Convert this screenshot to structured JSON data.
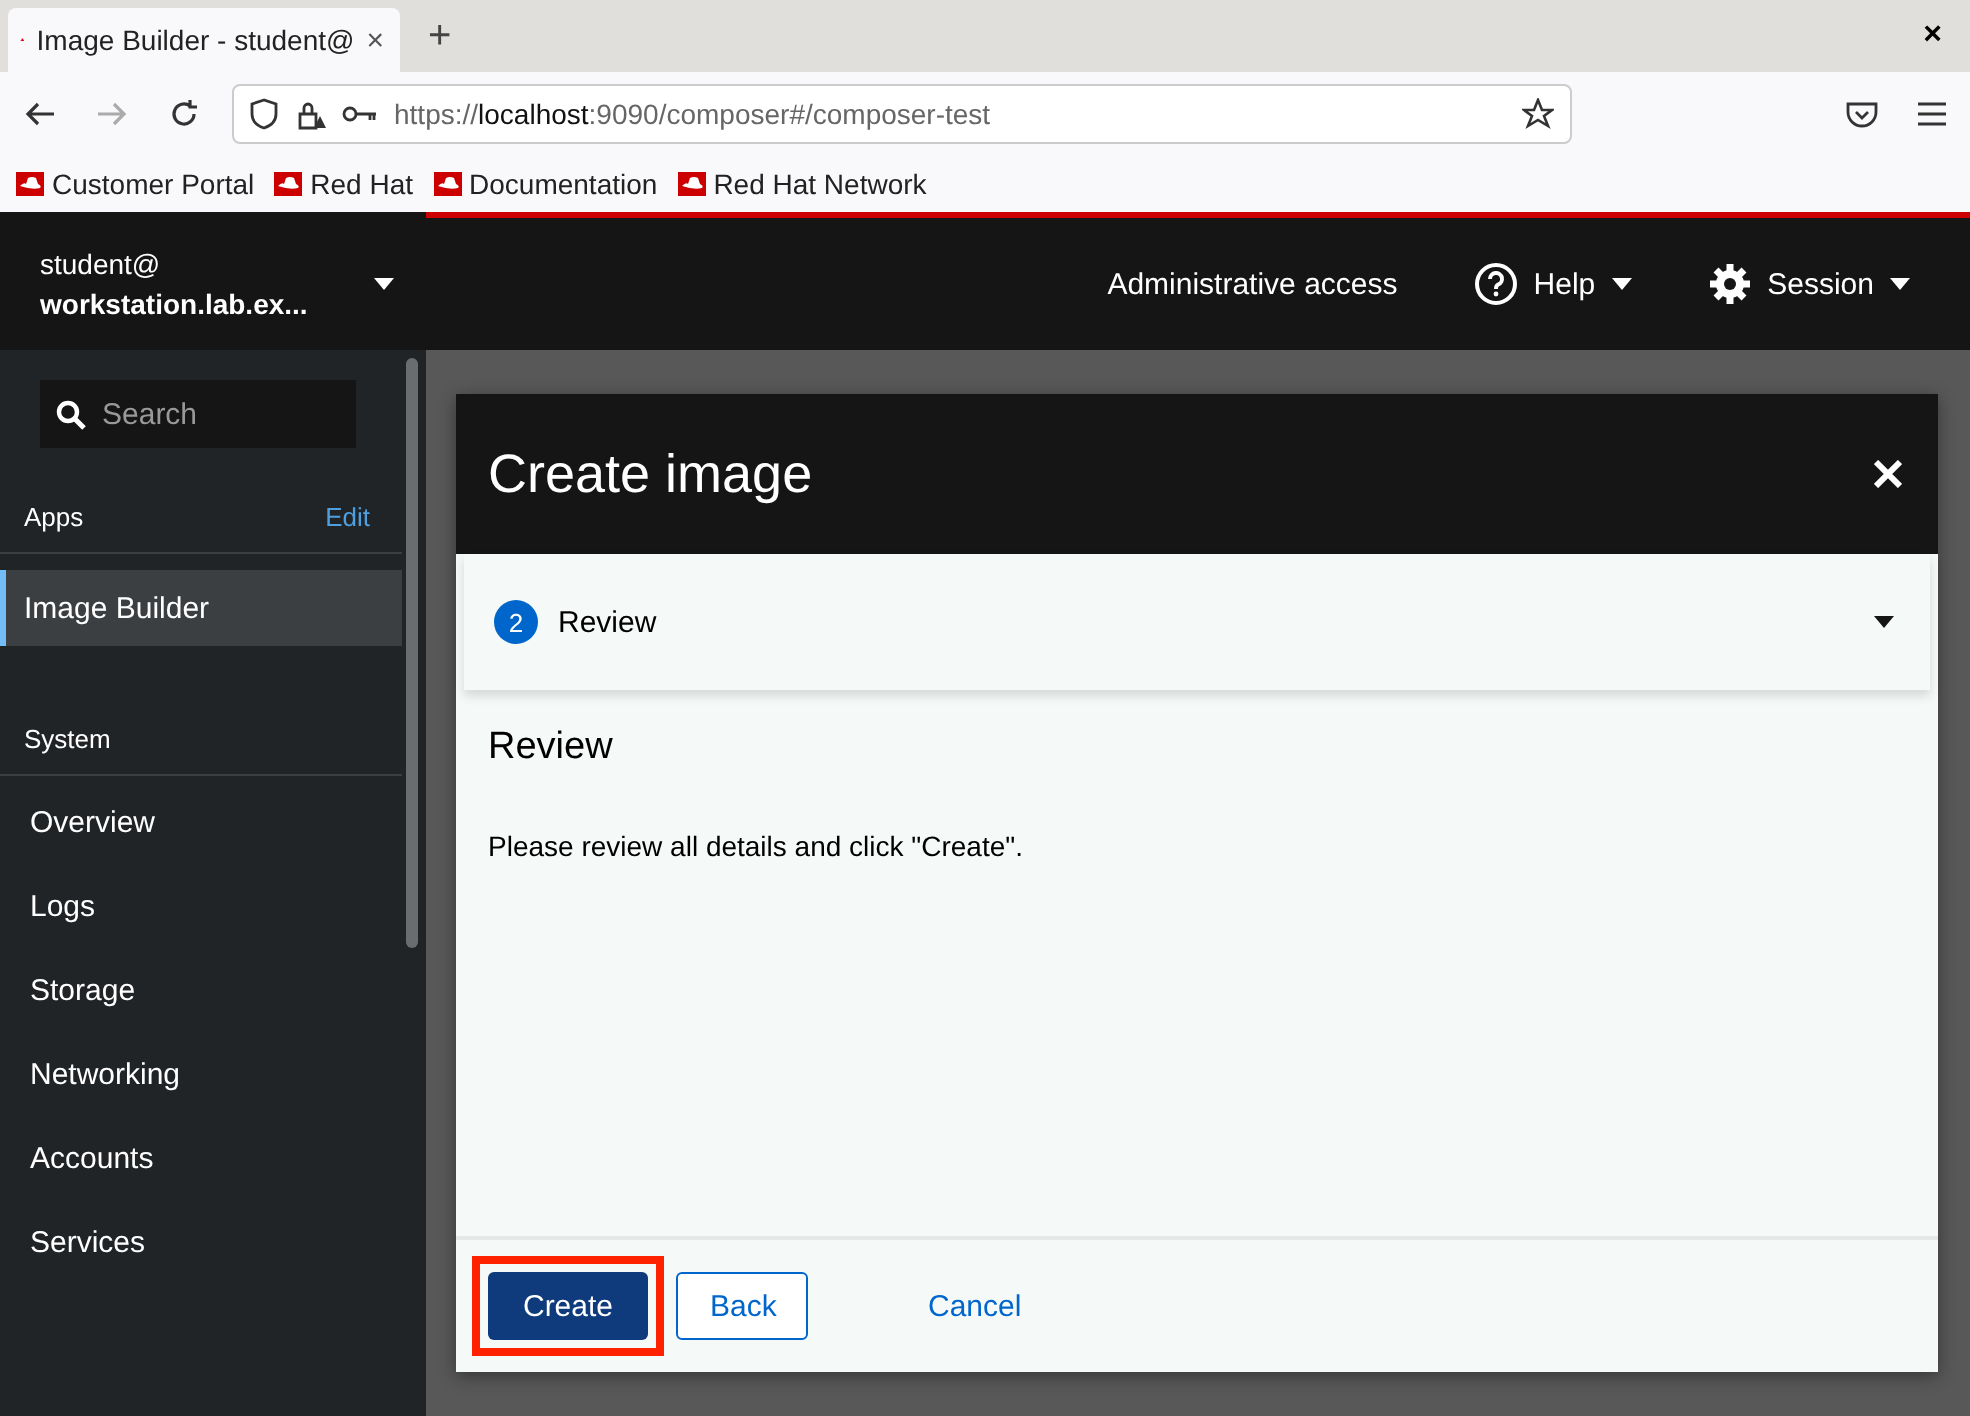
{
  "browser": {
    "tab_title": "Image Builder - student@",
    "new_tab": "+",
    "close": "×",
    "url_prefix": "https://",
    "url_host": "localhost",
    "url_rest": ":9090/composer#/composer-test",
    "bookmarks": [
      "Customer Portal",
      "Red Hat",
      "Documentation",
      "Red Hat Network"
    ]
  },
  "host": {
    "user": "student@",
    "machine": "workstation.lab.ex..."
  },
  "search": {
    "placeholder": "Search"
  },
  "sidebar": {
    "apps_label": "Apps",
    "edit": "Edit",
    "apps": [
      {
        "label": "Image Builder",
        "selected": true
      }
    ],
    "system_label": "System",
    "items": [
      {
        "label": "Overview",
        "selected": false
      },
      {
        "label": "Logs",
        "selected": false
      },
      {
        "label": "Storage",
        "selected": false
      },
      {
        "label": "Networking",
        "selected": false
      },
      {
        "label": "Accounts",
        "selected": false
      },
      {
        "label": "Services",
        "selected": false
      }
    ]
  },
  "topbar": {
    "admin": "Administrative access",
    "help": "Help",
    "session": "Session"
  },
  "modal": {
    "title": "Create image",
    "step_number": "2",
    "step_label": "Review",
    "heading": "Review",
    "text": "Please review all details and click \"Create\".",
    "buttons": [
      {
        "label": "Create",
        "kind": "primary",
        "highlighted": true
      },
      {
        "label": "Back",
        "kind": "secondary",
        "highlighted": false
      },
      {
        "label": "Cancel",
        "kind": "link",
        "highlighted": false
      }
    ]
  }
}
